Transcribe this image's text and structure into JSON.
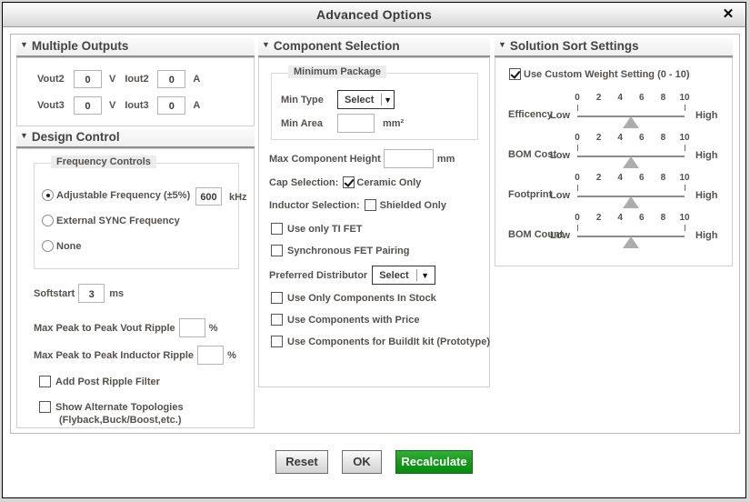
{
  "window": {
    "title": "Advanced Options",
    "close_icon": "close-icon",
    "close_glyph": "✕"
  },
  "panels": {
    "multiple_outputs": {
      "title": "Multiple Outputs",
      "collapse_glyph": "▼",
      "rows": [
        {
          "vlabel": "Vout2",
          "vvalue": "0",
          "vunit": "V",
          "ilabel": "Iout2",
          "ivalue": "0",
          "iunit": "A"
        },
        {
          "vlabel": "Vout3",
          "vvalue": "0",
          "vunit": "V",
          "ilabel": "Iout3",
          "ivalue": "0",
          "iunit": "A"
        }
      ]
    },
    "design_control": {
      "title": "Design Control",
      "collapse_glyph": "▼",
      "frequency_legend": "Frequency Controls",
      "radios": [
        {
          "label": "Adjustable Frequency (±5%)",
          "checked": true
        },
        {
          "label": "External  SYNC Frequency",
          "checked": false
        },
        {
          "label": "None",
          "checked": false
        }
      ],
      "frequency_value": "600",
      "frequency_unit": "kHz",
      "softstart_label": "Softstart",
      "softstart_value": "3",
      "softstart_unit": "ms",
      "vout_ripple_label": "Max Peak to Peak Vout Ripple",
      "vout_ripple_value": "",
      "vout_ripple_unit": "%",
      "inductor_ripple_label": "Max Peak to Peak Inductor Ripple",
      "inductor_ripple_value": "",
      "inductor_ripple_unit": "%",
      "checkboxes": [
        {
          "label": "Add Post Ripple Filter",
          "checked": false
        },
        {
          "label": "Show Alternate Topologies",
          "label2": "(Flyback,Buck/Boost,etc.)",
          "checked": false
        }
      ]
    },
    "component_selection": {
      "title": "Component Selection",
      "collapse_glyph": "▼",
      "min_package_legend": "Minimum Package",
      "min_type_label": "Min Type",
      "min_type_value": "Select",
      "min_area_label": "Min Area",
      "min_area_value": "",
      "min_area_unit": "mm²",
      "max_height_label": "Max Component Height",
      "max_height_value": "",
      "max_height_unit": "mm",
      "cap_selection_label": "Cap Selection:",
      "cap_selection_option": "Ceramic Only",
      "cap_selection_checked": true,
      "inductor_selection_label": "Inductor Selection:",
      "inductor_selection_option": "Shielded Only",
      "inductor_selection_checked": false,
      "ti_fet": {
        "label": "Use only TI FET",
        "checked": false
      },
      "sync_fet": {
        "label": "Synchronous FET Pairing",
        "checked": false
      },
      "distributor_label": "Preferred Distributor",
      "distributor_value": "Select",
      "in_stock": {
        "label": "Use Only Components In Stock",
        "checked": false
      },
      "with_price": {
        "label": "Use Components with Price",
        "checked": false
      },
      "buildit": {
        "label": "Use Components for BuildIt kit (Prototype)",
        "checked": false
      }
    },
    "solution_sort": {
      "title": "Solution Sort Settings",
      "collapse_glyph": "▼",
      "custom_weight": {
        "label": "Use Custom Weight Setting (0 - 10)",
        "checked": true
      },
      "low_label": "Low",
      "high_label": "High",
      "tick_labels": [
        "0",
        "2",
        "4",
        "6",
        "8",
        "10"
      ],
      "sliders": [
        {
          "name": "Efficency",
          "value": 5,
          "min": 0,
          "max": 10
        },
        {
          "name": "BOM Cost",
          "value": 5,
          "min": 0,
          "max": 10
        },
        {
          "name": "Footprint",
          "value": 5,
          "min": 0,
          "max": 10
        },
        {
          "name": "BOM Count",
          "value": 5,
          "min": 0,
          "max": 10
        }
      ]
    }
  },
  "footer": {
    "reset_label": "Reset",
    "ok_label": "OK",
    "recalculate_label": "Recalculate",
    "recalculate_color": "#16991c"
  }
}
